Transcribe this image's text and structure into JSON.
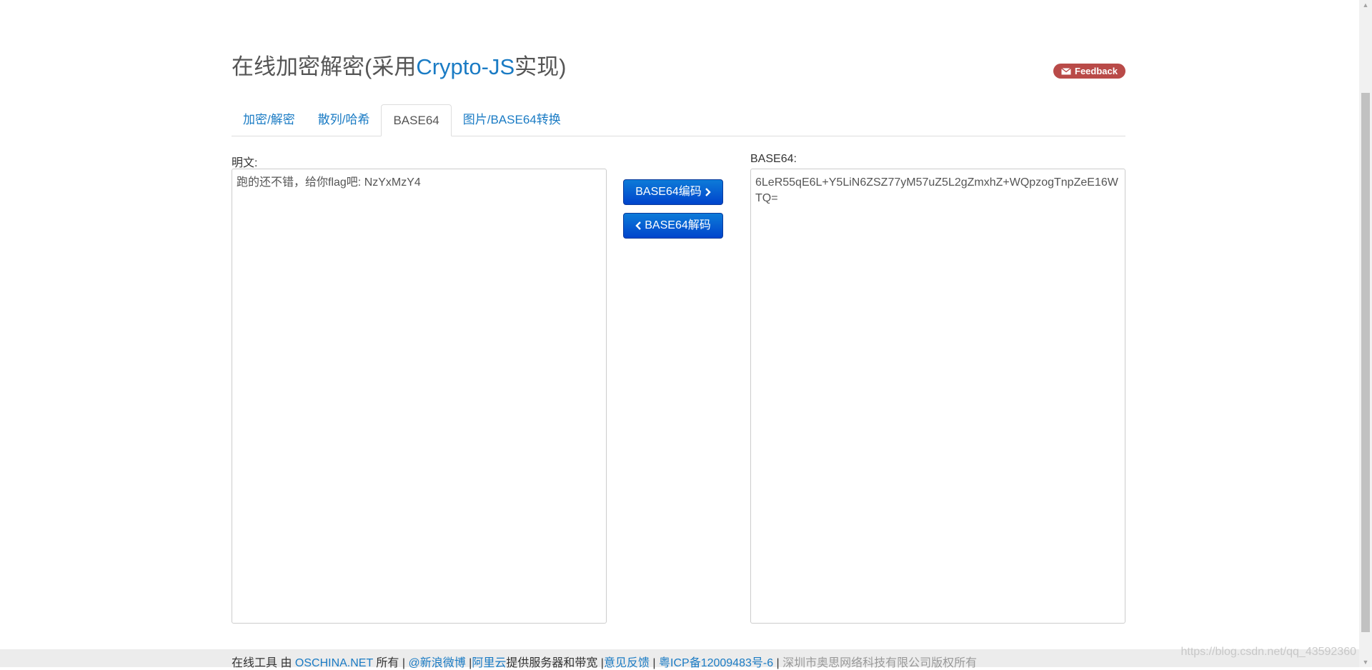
{
  "header": {
    "title_prefix": "在线加密解密(采用",
    "title_brand": "Crypto-JS",
    "title_suffix": "实现)",
    "feedback_label": "Feedback"
  },
  "tabs": [
    {
      "label": "加密/解密"
    },
    {
      "label": "散列/哈希"
    },
    {
      "label": "BASE64"
    },
    {
      "label": "图片/BASE64转换"
    }
  ],
  "plain": {
    "label": "明文:",
    "value": "跑的还不错，给你flag吧: NzYxMzY4"
  },
  "encoded": {
    "label": "BASE64:",
    "value": "6LeR55qE6L+Y5LiN6ZSZ77yM57uZ5L2gZmxhZ+WQpzogTnpZeE16WTQ="
  },
  "buttons": {
    "encode_label": "BASE64编码",
    "decode_label": "BASE64解码"
  },
  "footer": {
    "prefix": "在线工具 由 ",
    "oschina": "OSCHINA.NET",
    "owned": " 所有 | ",
    "weibo": "@新浪微博",
    "sep1": " |",
    "aliyun": "阿里云",
    "provides": "提供服务器和带宽 |",
    "feedback": "意见反馈",
    "sep2": " | ",
    "icp": "粤ICP备12009483号-6",
    "sep3": " | ",
    "company": "深圳市奥思网络科技有限公司版权所有"
  },
  "watermark": "https://blog.csdn.net/qq_43592360",
  "colors": {
    "link": "#1a7bc4",
    "button": "#0044cc",
    "feedback_badge": "#b94a48"
  },
  "icons": {
    "feedback": "envelope-icon",
    "encode": "chevron-right-icon",
    "decode": "chevron-left-icon"
  }
}
